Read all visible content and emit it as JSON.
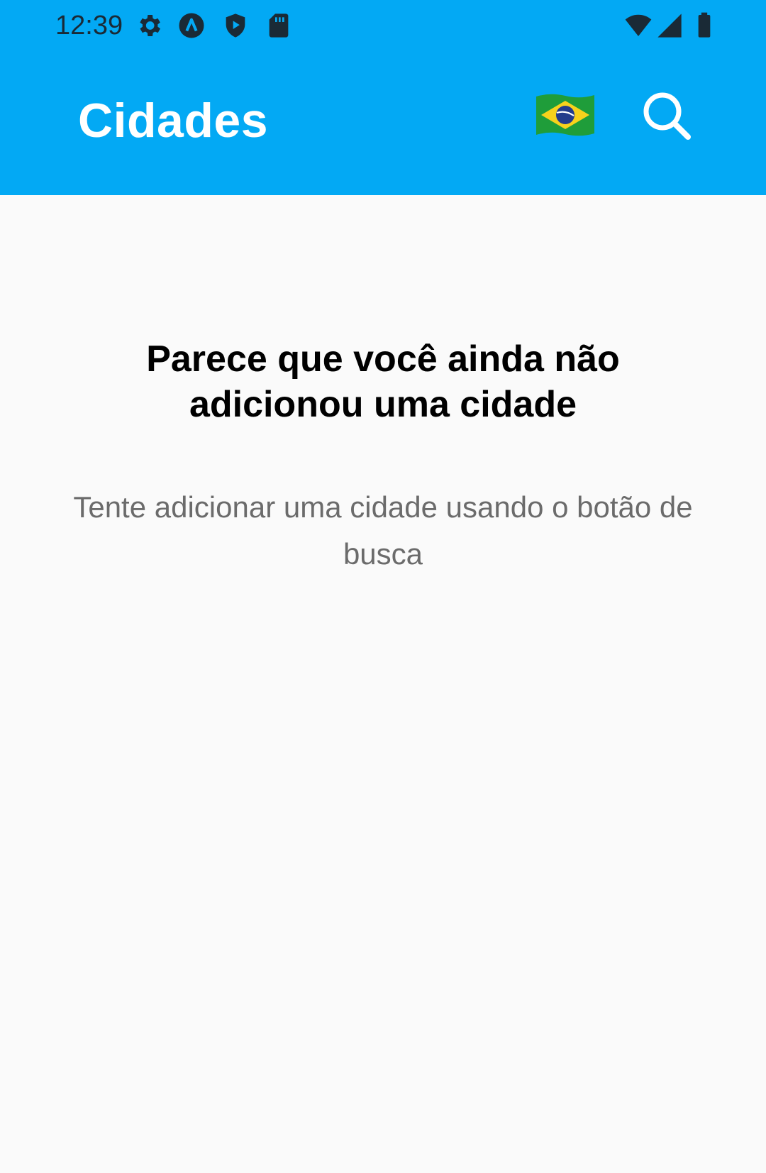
{
  "status_bar": {
    "time": "12:39",
    "icons": [
      "settings-icon",
      "a-circle-icon",
      "shield-play-icon",
      "sd-card-icon",
      "wifi-icon",
      "cell-signal-icon",
      "battery-icon"
    ]
  },
  "app_bar": {
    "title": "Cidades",
    "color": "#03a9f4",
    "actions": [
      "brazil-flag-icon",
      "search-icon"
    ]
  },
  "empty_state": {
    "title": "Parece que você ainda não adicionou uma cidade",
    "subtitle": "Tente adicionar uma cidade usando o botão de busca"
  }
}
